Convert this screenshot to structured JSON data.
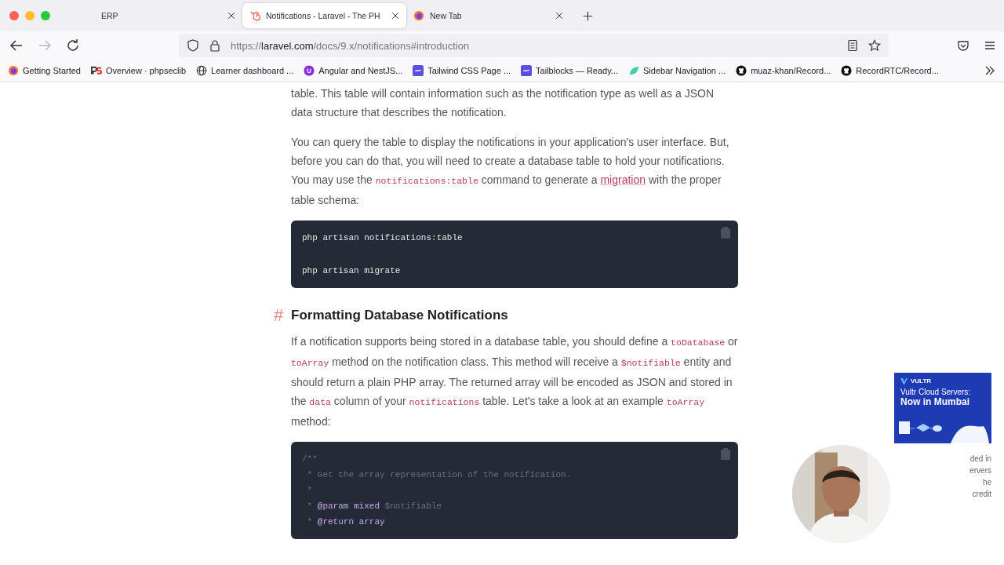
{
  "tabs": [
    {
      "label": "ERP",
      "selected": false
    },
    {
      "label": "Notifications - Laravel - The PH",
      "selected": true
    },
    {
      "label": "New Tab",
      "selected": false
    }
  ],
  "address_bar": {
    "url": "https://laravel.com/docs/9.x/notifications#introduction"
  },
  "bookmarks": [
    {
      "label": "Getting Started"
    },
    {
      "label": "Overview · phpseclib"
    },
    {
      "label": "Learner dashboard ..."
    },
    {
      "label": "Angular and NestJS..."
    },
    {
      "label": "Tailwind CSS Page ..."
    },
    {
      "label": "Tailblocks — Ready..."
    },
    {
      "label": "Sidebar Navigation ..."
    },
    {
      "label": "muaz-khan/Record..."
    },
    {
      "label": "RecordRTC/Record..."
    }
  ],
  "content": [
    {
      "kind": "paragraph",
      "parts": [
        {
          "kind": "text",
          "text": "table. This table will contain information such as the notification type as well as a JSON data structure that describes the notification."
        }
      ]
    },
    {
      "kind": "paragraph",
      "parts": [
        {
          "kind": "text",
          "text": "You can query the table to display the notifications in your application's user interface. But, before you can do that, you will need to create a database table to hold your notifications. You may use the "
        },
        {
          "kind": "code",
          "text": "notifications:table"
        },
        {
          "kind": "text",
          "text": " command to generate a "
        },
        {
          "kind": "link",
          "text": "migration"
        },
        {
          "kind": "text",
          "text": " with the proper table schema:"
        }
      ]
    },
    {
      "kind": "shell_block",
      "lines": [
        [
          {
            "kind": "plain",
            "text": "php artisan notifications:table"
          }
        ],
        [
          {
            "kind": "plain",
            "text": "php artisan migrate"
          }
        ]
      ]
    },
    {
      "kind": "heading",
      "text": "Formatting Database Notifications",
      "anchor": "#"
    },
    {
      "kind": "paragraph",
      "parts": [
        {
          "kind": "text",
          "text": "If a notification supports being stored in a database table, you should define a "
        },
        {
          "kind": "code",
          "text": "toDatabase"
        },
        {
          "kind": "text",
          "text": " or "
        },
        {
          "kind": "code",
          "text": "toArray"
        },
        {
          "kind": "text",
          "text": " method on the notification class. This method will receive a "
        },
        {
          "kind": "code",
          "text": "$notifiable"
        },
        {
          "kind": "text",
          "text": " entity and should return a plain PHP array. The returned array will be encoded as JSON and stored in the "
        },
        {
          "kind": "code",
          "text": "data"
        },
        {
          "kind": "text",
          "text": " column of your "
        },
        {
          "kind": "code",
          "text": "notifications"
        },
        {
          "kind": "text",
          "text": " table. Let's take a look at an example "
        },
        {
          "kind": "code",
          "text": "toArray"
        },
        {
          "kind": "text",
          "text": " method:"
        }
      ]
    },
    {
      "kind": "php_block",
      "lines": [
        [
          {
            "kind": "comment",
            "text": "/**"
          }
        ],
        [
          {
            "kind": "comment",
            "text": " * Get the array representation of the notification."
          }
        ],
        [
          {
            "kind": "comment",
            "text": " *"
          }
        ],
        [
          {
            "kind": "comment",
            "text": " *"
          },
          {
            "kind": "keyword",
            "text": "@param"
          },
          {
            "kind": "keyword",
            "text": "mixed"
          },
          {
            "kind": "comment",
            "text": "$notifiable"
          }
        ],
        [
          {
            "kind": "comment",
            "text": " *"
          },
          {
            "kind": "keyword",
            "text": "@return"
          },
          {
            "kind": "keyword",
            "text": "array"
          }
        ]
      ]
    }
  ],
  "ad": {
    "brand": "VULTR",
    "headline": "Vultr Cloud Servers:",
    "subhead": "Now in Mumbai",
    "text_lines": [
      "ded in",
      "ervers",
      "he",
      "credit"
    ]
  }
}
